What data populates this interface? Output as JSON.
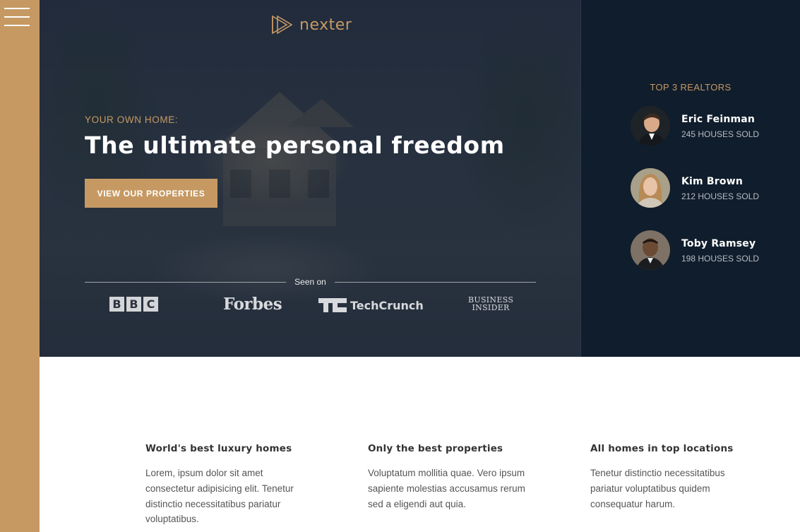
{
  "sidebar": {
    "menu_icon": "hamburger-menu-icon"
  },
  "header": {
    "logo_text": "nexter",
    "subtitle": "YOUR OWN HOME:",
    "title": "The ultimate personal freedom",
    "cta_label": "VIEW OUR PROPERTIES",
    "seen_on": "Seen on",
    "press": {
      "bbc": [
        "B",
        "B",
        "C"
      ],
      "forbes": "Forbes",
      "techcrunch": "TechCrunch",
      "business_insider_line1": "BUSINESS",
      "business_insider_line2": "INSIDER"
    }
  },
  "realtors": {
    "heading": "TOP 3 REALTORS",
    "items": [
      {
        "name": "Eric Feinman",
        "sold": "245 HOUSES SOLD"
      },
      {
        "name": "Kim Brown",
        "sold": "212 HOUSES SOLD"
      },
      {
        "name": "Toby Ramsey",
        "sold": "198 HOUSES SOLD"
      }
    ]
  },
  "features": [
    {
      "title": "World's best luxury homes",
      "text": "Lorem, ipsum dolor sit amet consectetur adipisicing elit. Tenetur distinctio necessitatibus pariatur voluptatibus."
    },
    {
      "title": "Only the best properties",
      "text": "Voluptatum mollitia quae. Vero ipsum sapiente molestias accusamus rerum sed a eligendi aut quia."
    },
    {
      "title": "All homes in top locations",
      "text": "Tenetur distinctio necessitatibus pariatur voluptatibus quidem consequatur harum."
    }
  ],
  "colors": {
    "accent": "#c69963",
    "dark": "#101d2c"
  }
}
